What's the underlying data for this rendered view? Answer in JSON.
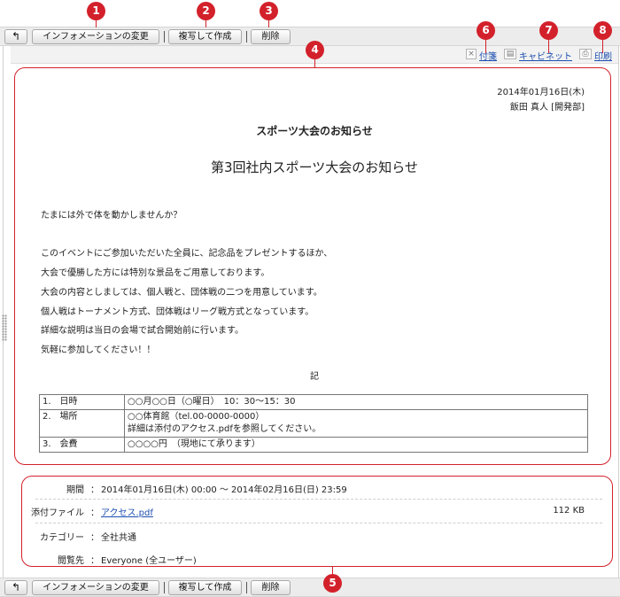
{
  "toolbar": {
    "back_glyph": "↰",
    "change_label": "インフォメーションの変更",
    "copy_label": "複写して作成",
    "delete_label": "削除"
  },
  "markers": [
    "1",
    "2",
    "3",
    "4",
    "5",
    "6",
    "7",
    "8"
  ],
  "actions": {
    "tag_label": "付箋",
    "cabinet_label": "キャビネット",
    "print_label": "印刷"
  },
  "document": {
    "date": "2014年01月16日(木)",
    "author": "飯田 真人 [開発部]",
    "subject": "スポーツ大会のお知らせ",
    "heading": "第3回社内スポーツ大会のお知らせ",
    "body": [
      "たまには外で体を動かしませんか？",
      "このイベントにご参加いただいた全員に、記念品をプレゼントするほか、",
      "大会で優勝した方には特別な景品をご用意しております。",
      "大会の内容としましては、個人戦と、団体戦の二つを用意しています。",
      "個人戦はトーナメント方式、団体戦はリーグ戦方式となっています。",
      "詳細な説明は当日の会場で試合開始前に行います。",
      "気軽に参加してください！！"
    ],
    "ki": "記",
    "table": [
      {
        "label": "1.　日時",
        "value": "○○月○○日（○曜日）　10：30〜15：30",
        "value2": ""
      },
      {
        "label": "2.　場所",
        "value": "○○体育館（tel.00-0000-0000）",
        "value2": "詳細は添付のアクセス.pdfを参照してください。"
      },
      {
        "label": "3.　会費",
        "value": "○○○○円　（現地にて承ります）",
        "value2": ""
      }
    ]
  },
  "meta": {
    "period_label": "期間",
    "period_value": "2014年01月16日(木) 00:00 〜 2014年02月16日(日) 23:59",
    "attach_label": "添付ファイル",
    "attach_name": "アクセス.pdf",
    "attach_size": "112 KB",
    "category_label": "カテゴリー",
    "category_value": "全社共通",
    "viewer_label": "閲覧先",
    "viewer_value": "Everyone (全ユーザー)",
    "colon": "："
  },
  "colors": {
    "marker": "#d3212b",
    "link": "#1d4fb0"
  }
}
